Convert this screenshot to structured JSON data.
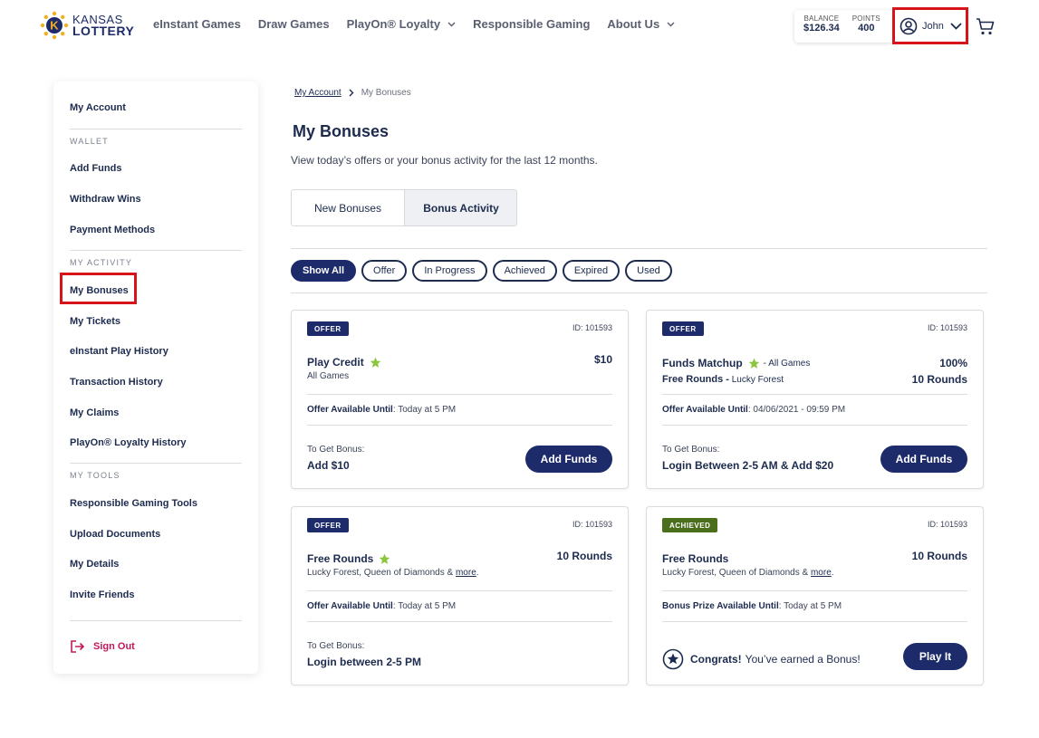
{
  "header": {
    "logo": {
      "line1": "KANSAS",
      "line2": "LOTTERY"
    },
    "nav": [
      {
        "label": "eInstant Games",
        "dropdown": false
      },
      {
        "label": "Draw Games",
        "dropdown": false
      },
      {
        "label": "PlayOn® Loyalty",
        "dropdown": true
      },
      {
        "label": "Responsible Gaming",
        "dropdown": false
      },
      {
        "label": "About Us",
        "dropdown": true
      }
    ],
    "balance_label": "BALANCE",
    "balance_value": "$126.34",
    "points_label": "POINTS",
    "points_value": "400",
    "user_name": "John"
  },
  "sidebar": {
    "my_account": "My Account",
    "sections": {
      "wallet": "WALLET",
      "my_activity": "MY ACTIVITY",
      "my_tools": "MY TOOLS"
    },
    "wallet_items": [
      "Add Funds",
      "Withdraw Wins",
      "Payment Methods"
    ],
    "activity_items": [
      "My Bonuses",
      "My Tickets",
      "eInstant Play History",
      "Transaction History",
      "My Claims",
      "PlayOn® Loyalty History"
    ],
    "tools_items": [
      "Responsible Gaming Tools",
      "Upload Documents",
      "My Details",
      "Invite Friends"
    ],
    "sign_out": "Sign Out"
  },
  "breadcrumb": {
    "parent": "My Account",
    "current": "My Bonuses"
  },
  "page": {
    "title": "My Bonuses",
    "subtitle": "View today’s offers or your bonus activity for the last 12 months."
  },
  "toggle": {
    "option1": "New Bonuses",
    "option2": "Bonus Activity",
    "selected": "Bonus Activity"
  },
  "filters": [
    "Show All",
    "Offer",
    "In Progress",
    "Achieved",
    "Expired",
    "Used"
  ],
  "filter_selected": "Show All",
  "cards": [
    {
      "badge": "OFFER",
      "id": "ID: 101593",
      "title": "Play Credit",
      "sub": "All Games",
      "amount": "$10",
      "avail_label": "Offer Available Until",
      "avail_value": ": Today at 5 PM",
      "get_label": "To Get Bonus:",
      "get_value": "Add $10",
      "button": "Add Funds"
    },
    {
      "badge": "OFFER",
      "id": "ID: 101593",
      "title": "Funds Matchup",
      "title_extra": "- All Games",
      "amount": "100%",
      "line2_title": "Free Rounds -",
      "line2_sub": " Lucky Forest",
      "amount2": "10 Rounds",
      "avail_label": "Offer Available Until",
      "avail_value": ": 04/06/2021 - 09:59 PM",
      "get_label": "To Get Bonus:",
      "get_value": "Login Between 2-5 AM & Add $20",
      "button": "Add Funds"
    },
    {
      "badge": "OFFER",
      "id": "ID: 101593",
      "title": "Free Rounds",
      "sub": "Lucky Forest, Queen of Diamonds &",
      "more": "more",
      "amount": "10 Rounds",
      "avail_label": "Offer Available Until",
      "avail_value": ": Today at 5 PM",
      "get_label": "To Get Bonus:",
      "get_value": "Login between 2-5 PM"
    },
    {
      "badge": "ACHIEVED",
      "id": "ID: 101593",
      "title": "Free Rounds",
      "sub": "Lucky Forest, Queen of Diamonds &",
      "more": "more",
      "amount": "10 Rounds",
      "avail_label": "Bonus Prize Available Until",
      "avail_value": ": Today at 5 PM",
      "congrats_bold": "Congrats!",
      "congrats_rest": "You’ve earned a Bonus!",
      "button": "Play It"
    }
  ]
}
